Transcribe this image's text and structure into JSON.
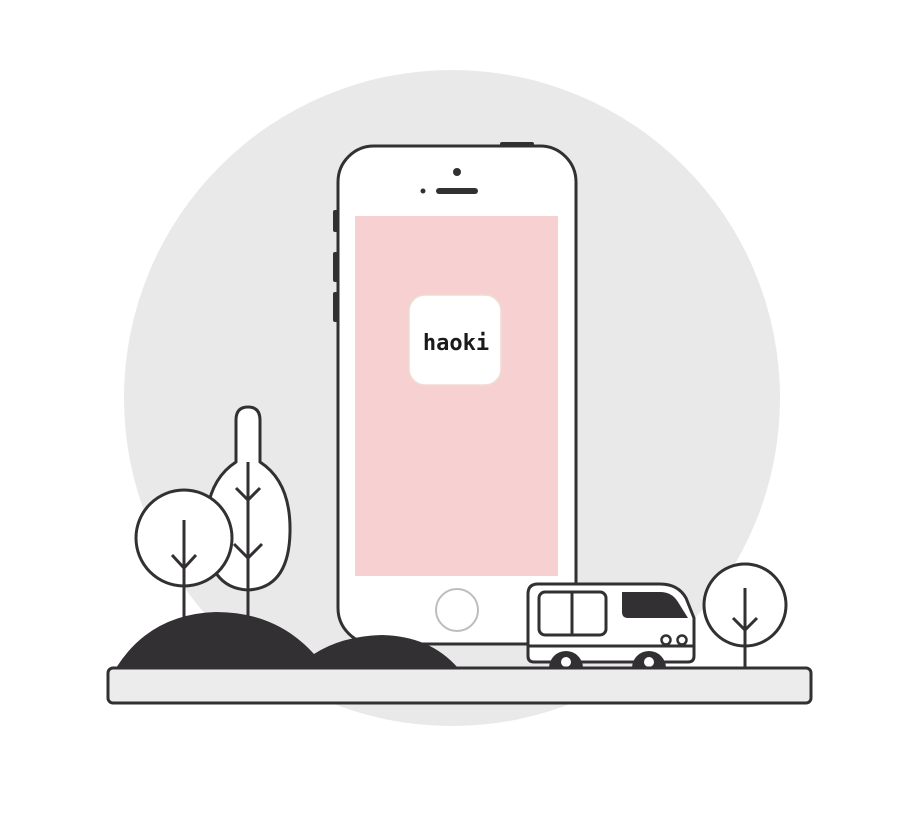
{
  "app": {
    "name": "haoki",
    "icon": "app-icon"
  },
  "colors": {
    "background_circle": "#e9e9e9",
    "outline": "#333033",
    "screen": "#f7d0d1",
    "phone_body": "#ffffff",
    "ground": "#ececec",
    "hills": "#333033",
    "vehicle_window": "#333033"
  },
  "illustration": {
    "device": "smartphone",
    "vehicle": "van",
    "trees": [
      "round-tree",
      "tall-tree",
      "round-tree-small"
    ],
    "terrain": "hills"
  }
}
